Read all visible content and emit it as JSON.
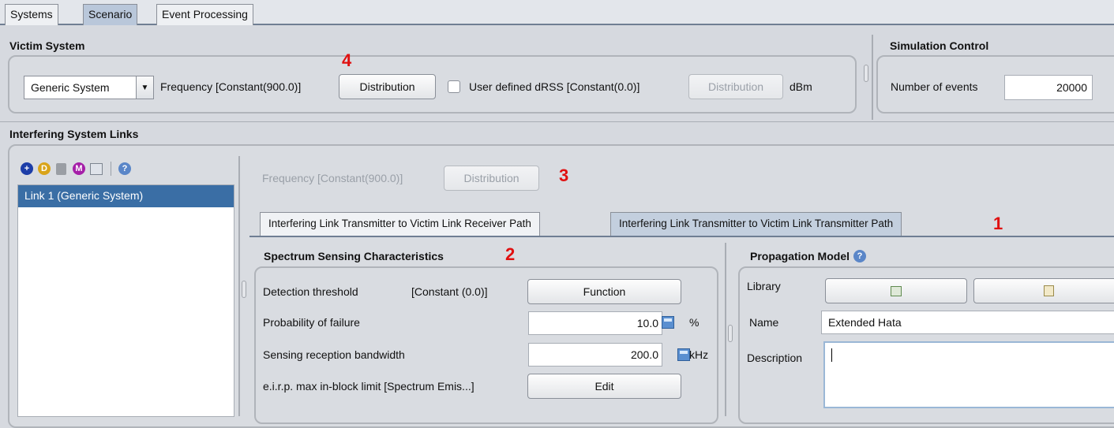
{
  "top_tabs": [
    {
      "label": "Systems"
    },
    {
      "label": "Scenario"
    },
    {
      "label": "Event Processing"
    }
  ],
  "victim": {
    "title": "Victim System",
    "system_select": "Generic System",
    "frequency": "Frequency [Constant(900.0)]",
    "distribution_btn": "Distribution",
    "user_dRSS_label": "User defined dRSS [Constant(0.0)]",
    "distribution_btn2": "Distribution",
    "unit": "dBm"
  },
  "simulation": {
    "title": "Simulation Control",
    "events_label": "Number of events",
    "events_value": "20000"
  },
  "interfering": {
    "title": "Interfering System Links",
    "links": [
      "Link 1 (Generic System)"
    ],
    "frequency": "Frequency [Constant(900.0)]",
    "distribution_btn": "Distribution"
  },
  "path_tabs": [
    {
      "label": "Interfering Link Transmitter to Victim Link Receiver Path"
    },
    {
      "label": "Interfering Link Transmitter to Victim Link Transmitter Path"
    }
  ],
  "spectrum": {
    "title": "Spectrum Sensing Characteristics",
    "detection_label": "Detection threshold",
    "detection_value": "[Constant (0.0)]",
    "function_btn": "Function",
    "pfail_label": "Probability of failure",
    "pfail_value": "10.0",
    "pfail_unit": "%",
    "bw_label": "Sensing reception bandwidth",
    "bw_value": "200.0",
    "bw_unit": "kHz",
    "eirp_label": "e.i.r.p. max in-block limit [Spectrum Emis...]",
    "edit_btn": "Edit"
  },
  "propagation": {
    "title": "Propagation Model",
    "library_label": "Library",
    "name_label": "Name",
    "name_value": "Extended Hata",
    "description_label": "Description",
    "description_value": ""
  },
  "annotations": {
    "n1": "1",
    "n2": "2",
    "n3": "3",
    "n4": "4"
  },
  "colors": {
    "accent_selected": "#3a6ea5",
    "annotation_red": "#e01010"
  }
}
